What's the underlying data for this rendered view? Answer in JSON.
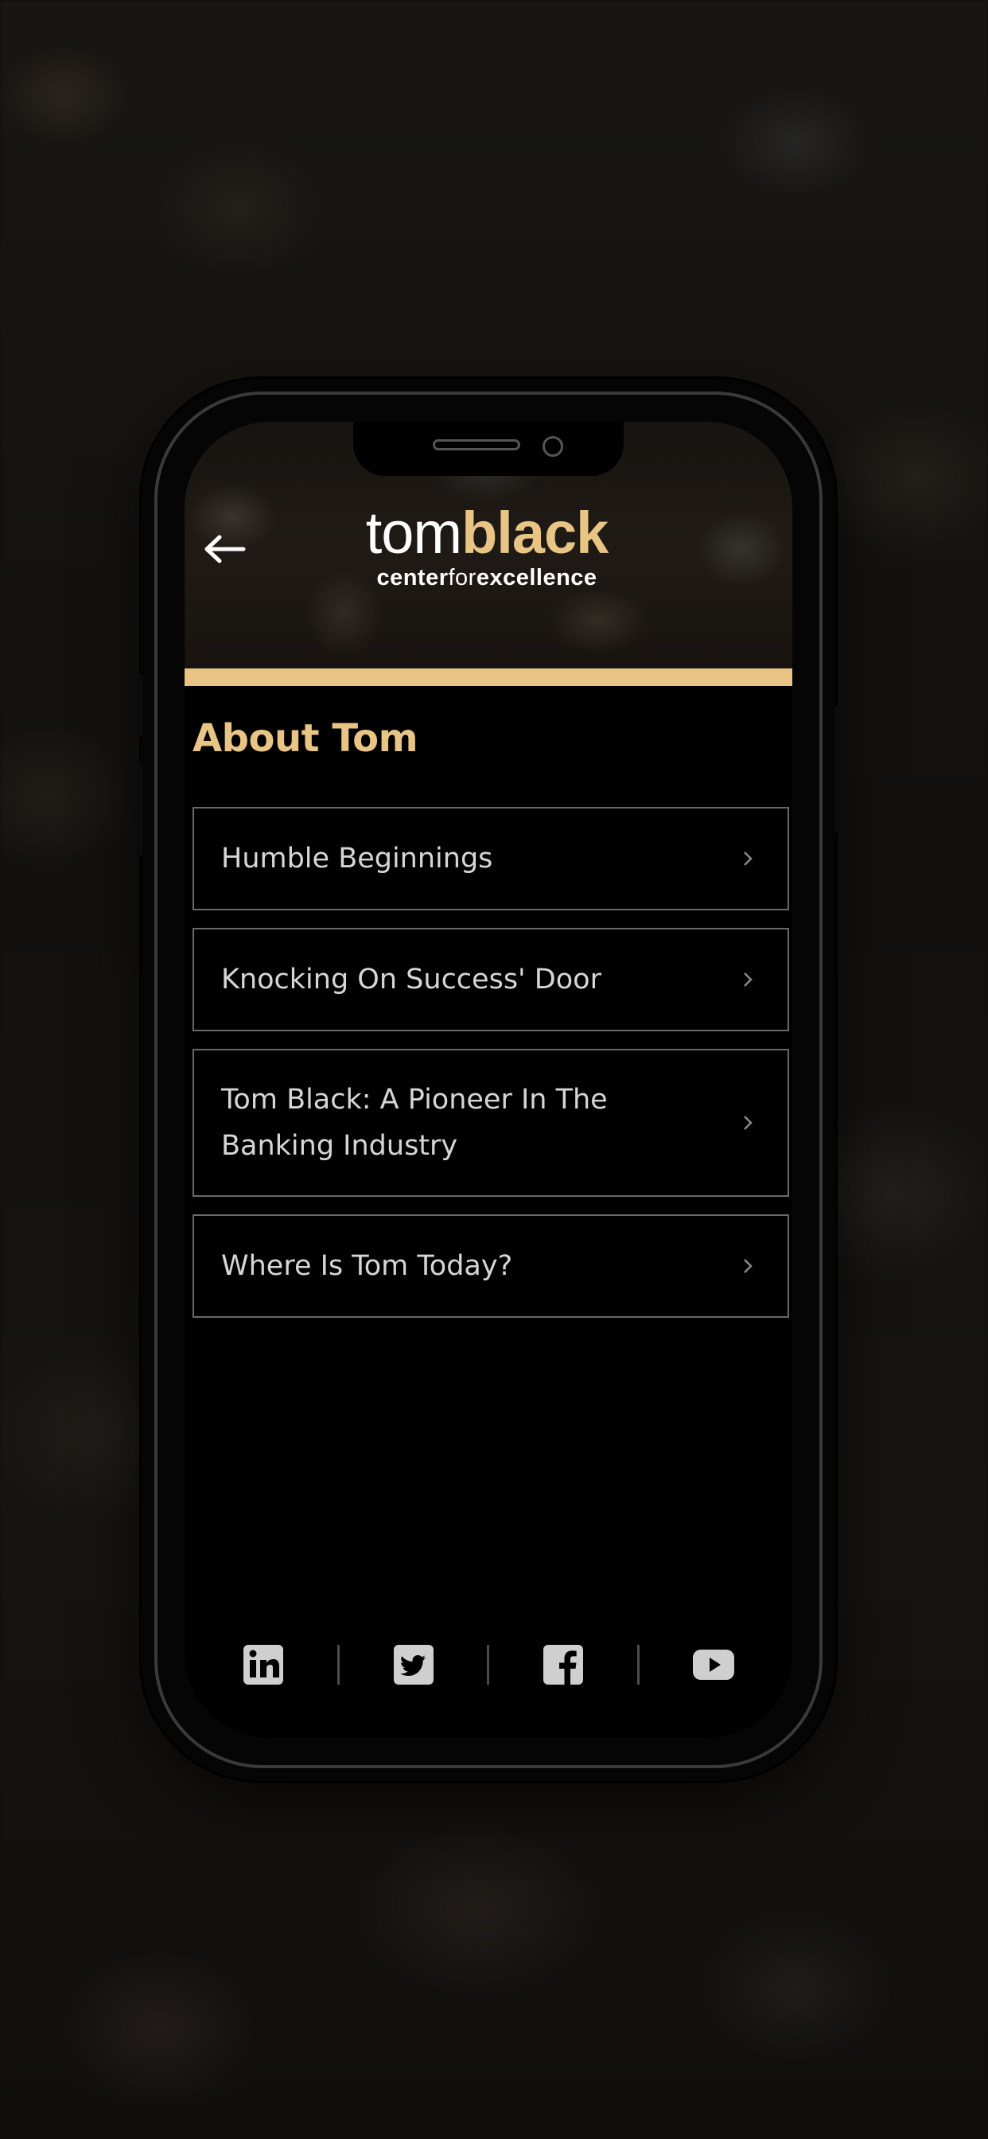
{
  "header": {
    "logo_word1": "tom",
    "logo_word2": "black",
    "logo_sub_a": "center",
    "logo_sub_b": "for",
    "logo_sub_c": "excellence",
    "back_icon": "arrow-left-icon"
  },
  "page": {
    "title": "About Tom"
  },
  "menu": {
    "items": [
      {
        "label": "Humble Beginnings"
      },
      {
        "label": "Knocking On Success' Door"
      },
      {
        "label": "Tom Black: A Pioneer In The Banking Industry"
      },
      {
        "label": "Where Is Tom Today?"
      }
    ]
  },
  "social": {
    "icons": [
      "linkedin-icon",
      "twitter-icon",
      "facebook-icon",
      "youtube-icon"
    ]
  },
  "colors": {
    "accent": "#e8c584",
    "background": "#000000",
    "item_text": "#d6d6d6",
    "item_border": "#6a6a6a",
    "icon": "#cfcfcf"
  }
}
